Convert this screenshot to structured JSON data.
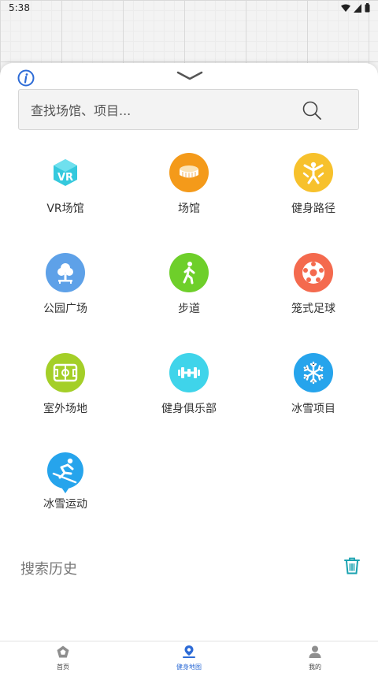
{
  "status_bar": {
    "time": "5:38"
  },
  "search": {
    "placeholder": "查找场馆、项目..."
  },
  "categories": [
    {
      "label": "VR场馆",
      "icon": "vr-icon",
      "color": "#ffffff"
    },
    {
      "label": "场馆",
      "icon": "stadium-icon",
      "color": "#f49a1a"
    },
    {
      "label": "健身路径",
      "icon": "fitness-path-icon",
      "color": "#f7c12c"
    },
    {
      "label": "公园广场",
      "icon": "tree-icon",
      "color": "#5ea1e8"
    },
    {
      "label": "步道",
      "icon": "walking-icon",
      "color": "#6ecf2a"
    },
    {
      "label": "笼式足球",
      "icon": "football-icon",
      "color": "#f46a4e"
    },
    {
      "label": "室外场地",
      "icon": "field-icon",
      "color": "#a4cf28"
    },
    {
      "label": "健身俱乐部",
      "icon": "dumbbell-icon",
      "color": "#3fd4ea"
    },
    {
      "label": "冰雪项目",
      "icon": "snowflake-icon",
      "color": "#26a4ec"
    },
    {
      "label": "冰雪运动",
      "icon": "skiing-icon",
      "color": "#26a4ec"
    }
  ],
  "history": {
    "title": "搜索历史"
  },
  "nav": [
    {
      "label": "首页",
      "icon": "home-icon"
    },
    {
      "label": "健身地图",
      "icon": "map-pin-icon",
      "active": true
    },
    {
      "label": "我的",
      "icon": "user-icon"
    }
  ],
  "colors": {
    "accent": "#2d6bd6",
    "teal": "#1aa2b0"
  }
}
